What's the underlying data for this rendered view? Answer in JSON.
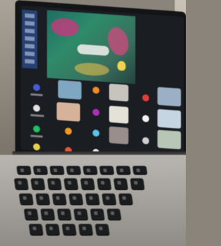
{
  "scene": {
    "description_type": "photo",
    "colors": {
      "screen": "#1a1d22",
      "share_bg": "#2e8b6a",
      "share_accent": "#c63a7d",
      "toolbar": "#2b4b8a",
      "laptop": "#a9a6a1",
      "keys": "#1b1c1e"
    },
    "icons": [
      "video-tile",
      "mic-muted-icon",
      "avatar",
      "keyboard-key",
      "bulb-icon"
    ]
  }
}
